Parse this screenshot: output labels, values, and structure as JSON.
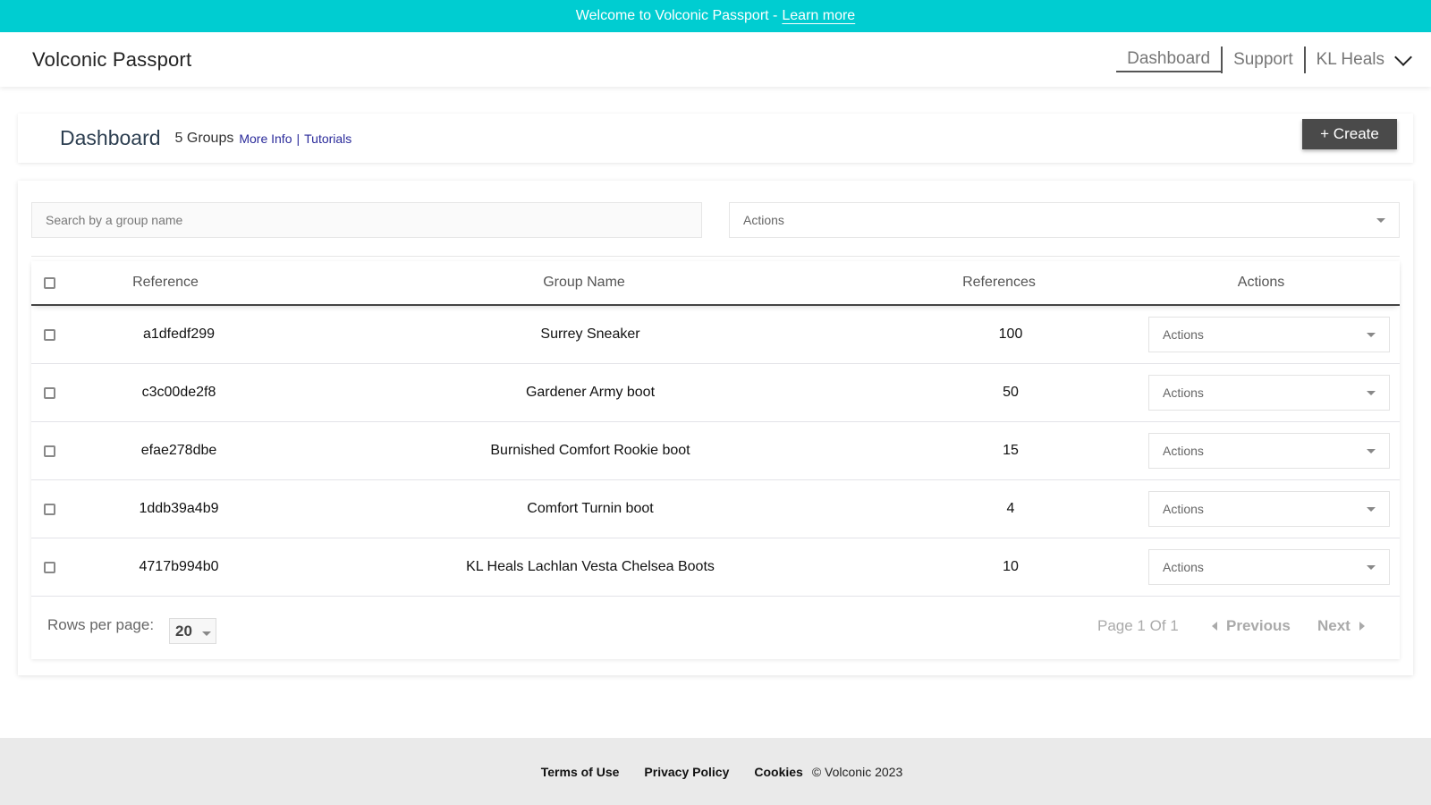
{
  "banner": {
    "text": "Welcome to Volconic Passport -",
    "link_label": "Learn more"
  },
  "topbar": {
    "brand": "Volconic Passport",
    "nav": [
      {
        "label": "Dashboard",
        "active": true
      },
      {
        "label": "Support",
        "active": false
      }
    ],
    "user": {
      "name": "KL Heals",
      "icon": "chevron-down-icon"
    }
  },
  "page_header": {
    "title": "Dashboard",
    "group_count": "5 Groups",
    "more_info_label": "More Info",
    "separator": "|",
    "tutorials_label": "Tutorials",
    "create_label": "+ Create"
  },
  "filters": {
    "search_placeholder": "Search by a group name",
    "search_value": "",
    "bulk_action_selected": "Actions"
  },
  "table": {
    "columns": [
      "Reference",
      "Group Name",
      "References",
      "Actions"
    ],
    "rows": [
      {
        "reference": "a1dfedf299",
        "group_name": "Surrey Sneaker",
        "references": "100",
        "action": "Actions"
      },
      {
        "reference": "c3c00de2f8",
        "group_name": "Gardener Army boot",
        "references": "50",
        "action": "Actions"
      },
      {
        "reference": "efae278dbe",
        "group_name": "Burnished Comfort Rookie boot",
        "references": "15",
        "action": "Actions"
      },
      {
        "reference": "1ddb39a4b9",
        "group_name": "Comfort Turnin boot",
        "references": "4",
        "action": "Actions"
      },
      {
        "reference": "4717b994b0",
        "group_name": "KL Heals Lachlan Vesta Chelsea Boots",
        "references": "10",
        "action": "Actions"
      }
    ]
  },
  "pagination": {
    "rows_per_page_label": "Rows per page:",
    "rows_per_page_value": "20",
    "page_info": "Page 1 Of 1",
    "previous_label": "Previous",
    "next_label": "Next"
  },
  "footer": {
    "links": [
      "Terms of Use",
      "Privacy Policy",
      "Cookies"
    ],
    "copyright": "© Volconic 2023"
  },
  "colors": {
    "banner": "#00cdd1",
    "primary_button": "#4a4a4a",
    "link": "#2a2a9a",
    "footer_bg": "#eaeaea"
  }
}
